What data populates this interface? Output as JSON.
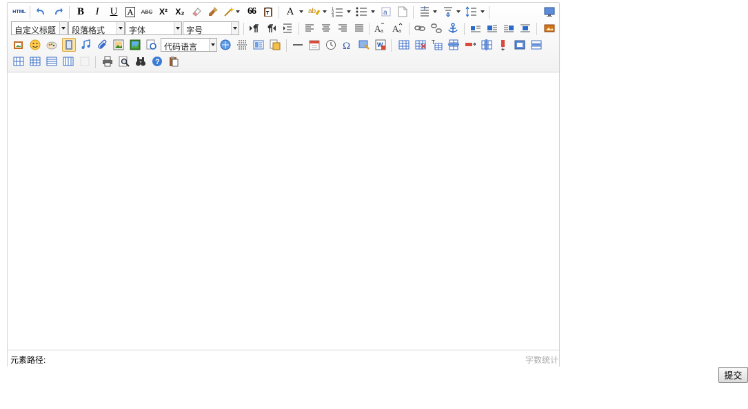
{
  "toolbar": {
    "html_label": "HTML",
    "bold": "B",
    "italic": "I",
    "underline": "U",
    "border_char": "A",
    "strike": "ABC",
    "superscript": "X²",
    "subscript": "X₂",
    "quote": "66",
    "font_color": "A",
    "custom_title": "自定义标题",
    "paragraph": "段落格式",
    "font_family": "字体",
    "font_size": "字号",
    "code_language": "代码语言"
  },
  "status": {
    "element_path_label": "元素路径:",
    "word_count_label": "字数统计"
  },
  "actions": {
    "submit_label": "提交"
  }
}
